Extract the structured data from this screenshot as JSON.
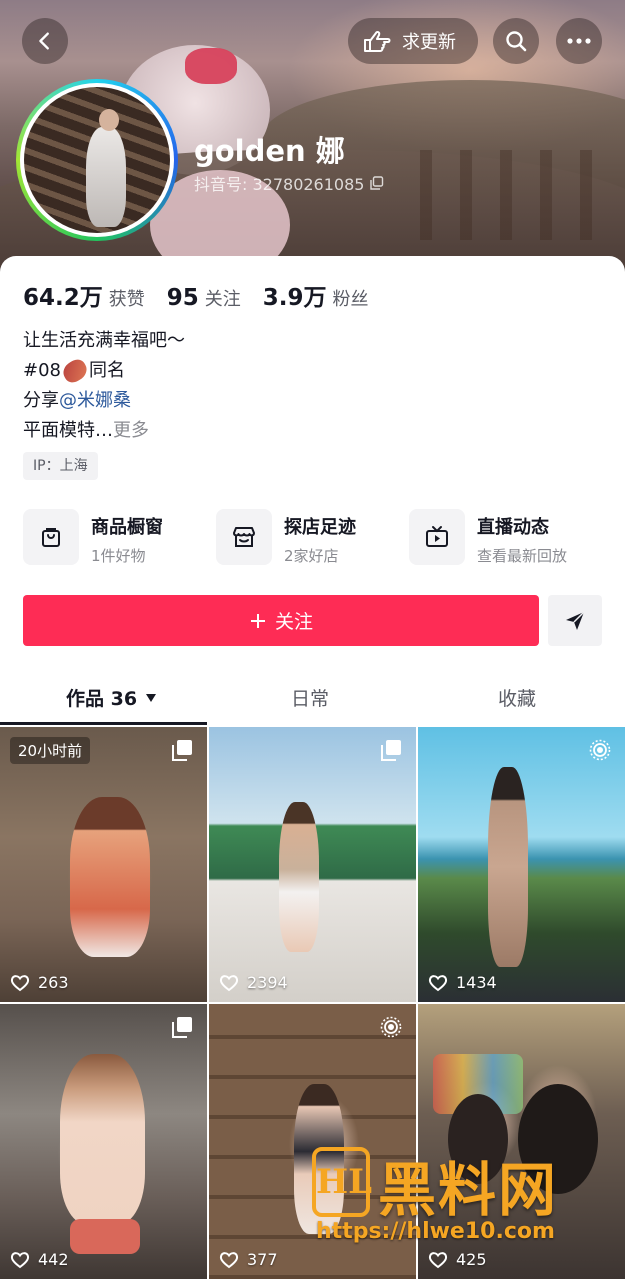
{
  "header": {
    "update_label": "求更新",
    "icons": [
      "chevron-left-icon",
      "hand-point-icon",
      "search-icon",
      "more-icon"
    ]
  },
  "profile": {
    "nickname": "golden 娜",
    "douyin_id": "抖音号: 32780261085",
    "stats": [
      {
        "num": "64.2万",
        "label": "获赞"
      },
      {
        "num": "95",
        "label": "关注"
      },
      {
        "num": "3.9万",
        "label": "粉丝"
      }
    ],
    "bio": {
      "line1": "让生活充满幸福吧～",
      "line2_prefix": "#08",
      "line2_suffix": "同名",
      "line3_prefix": "分享 ",
      "line3_mention": "@米娜桑",
      "line4_text": "平面模特…",
      "line4_more": " 更多"
    },
    "ip": "IP：上海"
  },
  "features": [
    {
      "title": "商品橱窗",
      "sub": "1件好物",
      "icon": "shopping-bag-icon"
    },
    {
      "title": "探店足迹",
      "sub": "2家好店",
      "icon": "store-icon"
    },
    {
      "title": "直播动态",
      "sub": "查看最新回放",
      "icon": "tv-icon"
    }
  ],
  "actions": {
    "follow_label": "关注",
    "share_icon": "send-icon"
  },
  "tabs": {
    "works_label": "作品 36",
    "daily_label": "日常",
    "fav_label": "收藏"
  },
  "grid": [
    {
      "likes": "263",
      "badge": "20小时前",
      "corner": "copy-icon"
    },
    {
      "likes": "2394",
      "corner": "copy-icon"
    },
    {
      "likes": "1434",
      "corner": "live-photo-icon"
    },
    {
      "likes": "442",
      "corner": "copy-icon"
    },
    {
      "likes": "377",
      "corner": "live-photo-icon"
    },
    {
      "likes": "425"
    }
  ],
  "watermark": {
    "logo": "HL",
    "title": "黑料网",
    "url": "https://hlwe10.com"
  },
  "colors": {
    "accent": "#fe2c55",
    "mention": "#2e5a9c",
    "watermark": "#f5a623"
  }
}
